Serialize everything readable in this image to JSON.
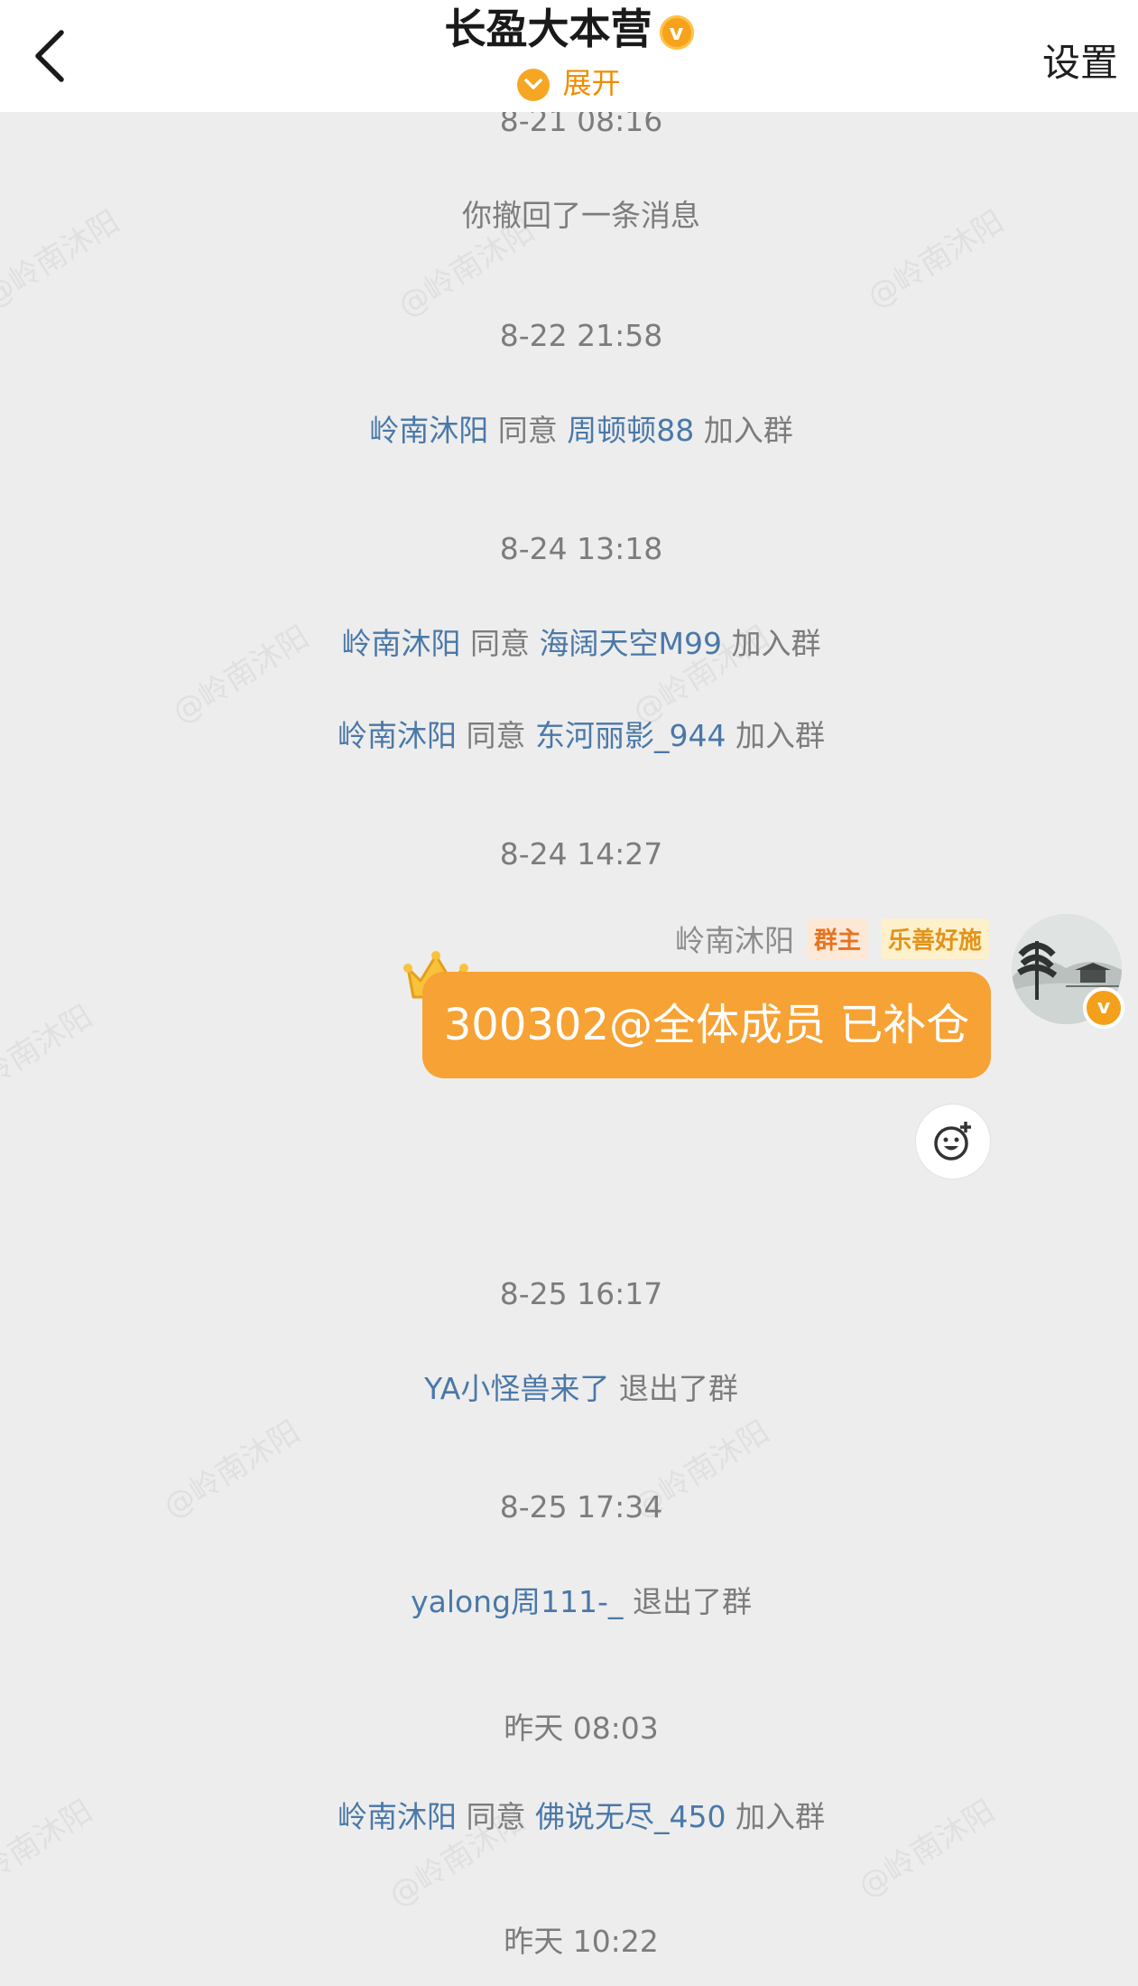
{
  "header": {
    "title": "长盈大本营",
    "verified_icon": "v-badge-icon",
    "expand_label": "展开",
    "settings_label": "设置"
  },
  "watermark": "@岭南沐阳",
  "feed": {
    "ts1": "8-21 08:16",
    "recall": "你撤回了一条消息",
    "ts2": "8-22 21:58",
    "ev1": {
      "actor": "岭南沐阳",
      "verb": "同意",
      "target": "周顿顿88",
      "action": "加入群"
    },
    "ts3": "8-24 13:18",
    "ev2": {
      "actor": "岭南沐阳",
      "verb": "同意",
      "target": "海阔天空M99",
      "action": "加入群"
    },
    "ev3": {
      "actor": "岭南沐阳",
      "verb": "同意",
      "target": "东河丽影_944",
      "action": "加入群"
    },
    "ts4": "8-24 14:27",
    "message": {
      "sender": "岭南沐阳",
      "tag_owner": "群主",
      "tag_title": "乐善好施",
      "text": "300302@全体成员 已补仓"
    },
    "ts5": "8-25 16:17",
    "ev4": {
      "actor": "YA小怪兽来了",
      "action": "退出了群"
    },
    "ts6": "8-25 17:34",
    "ev5": {
      "actor": "yalong周111-_",
      "action": "退出了群"
    },
    "ts7": "昨天 08:03",
    "ev6": {
      "actor": "岭南沐阳",
      "verb": "同意",
      "target": "佛说无尽_450",
      "action": "加入群"
    },
    "ts8": "昨天 10:22"
  },
  "colors": {
    "accent_orange": "#f7a234",
    "link_blue": "#4a78a8",
    "background": "#ededed"
  }
}
